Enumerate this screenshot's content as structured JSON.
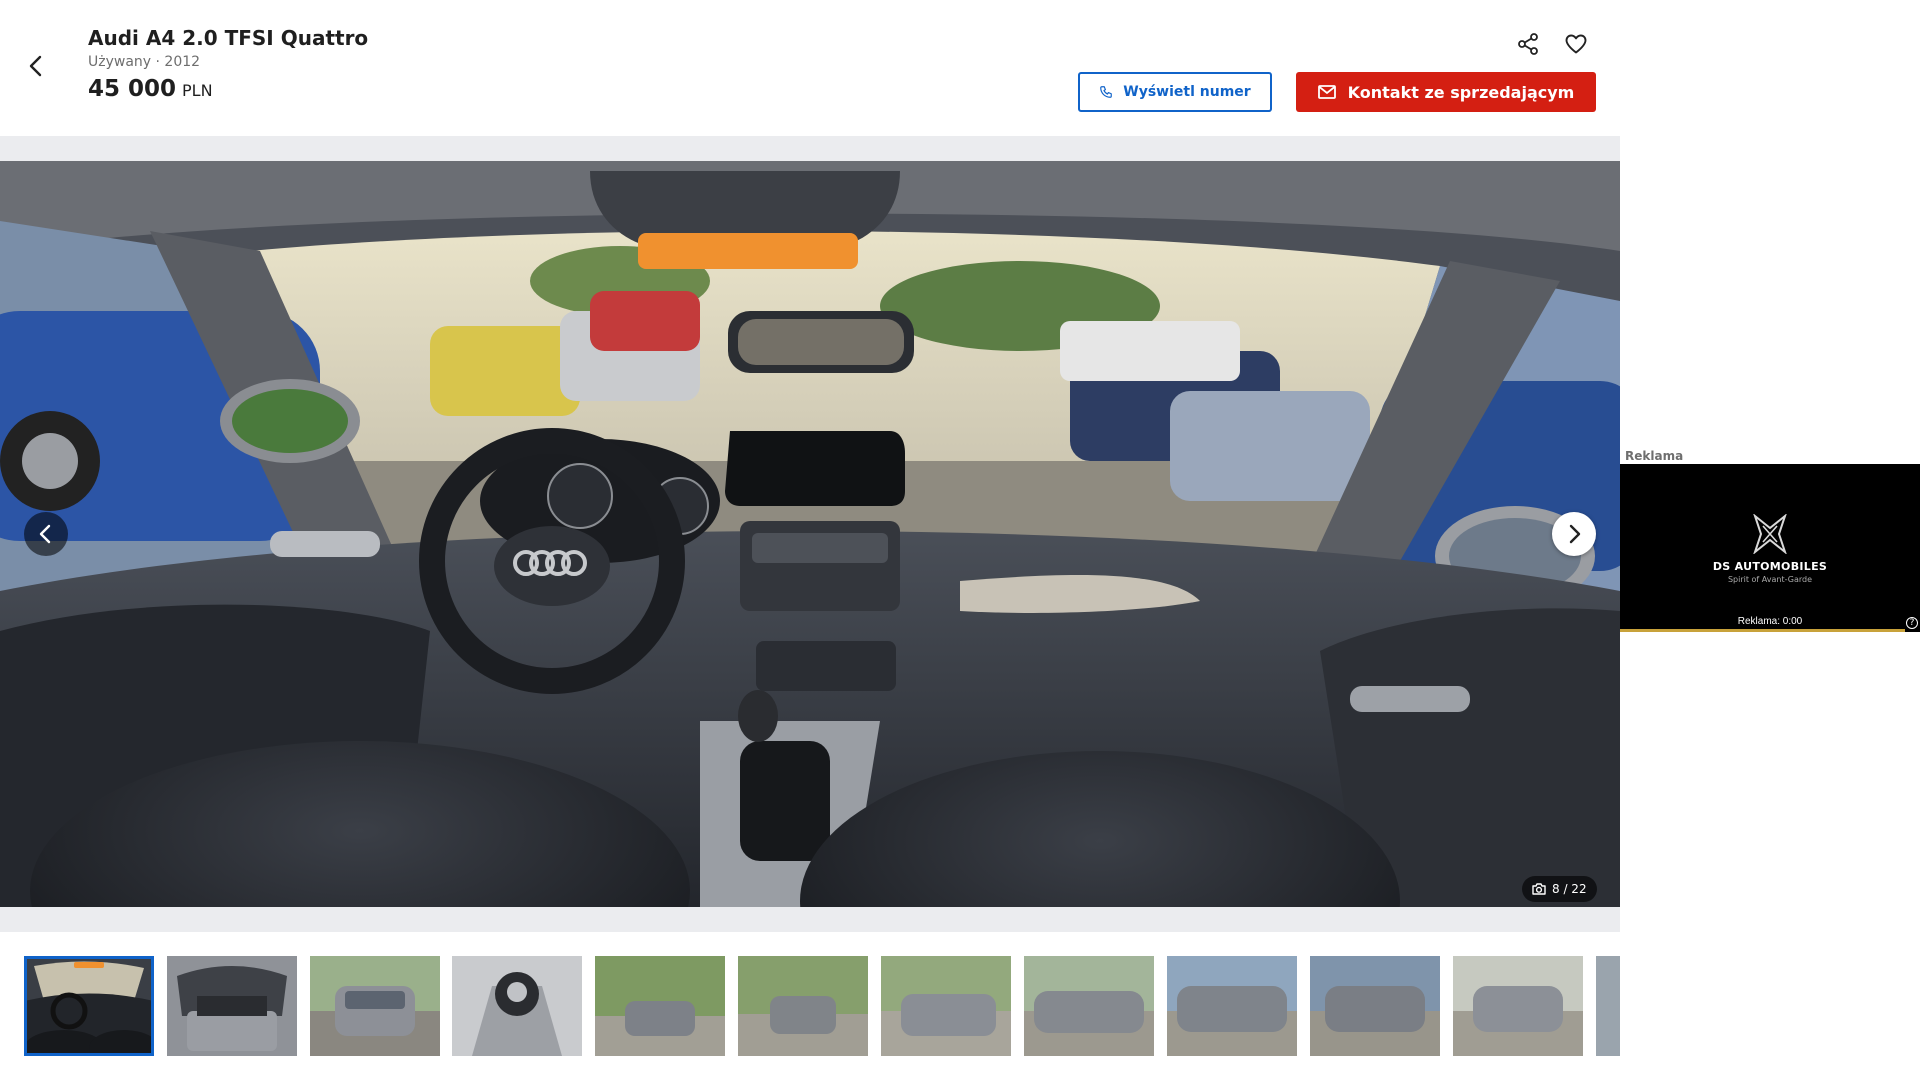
{
  "header": {
    "title": "Audi A4 2.0 TFSI Quattro",
    "subtitle": "Używany · 2012",
    "price_amount": "45 000",
    "price_currency": "PLN",
    "back_icon": "chevron-left-icon",
    "share_icon": "share-icon",
    "favorite_icon": "heart-icon"
  },
  "actions": {
    "phone_label": "Wyświetl numer",
    "contact_label": "Kontakt ze sprzedającym",
    "phone_color": "#1063c9",
    "contact_color": "#d41f12"
  },
  "gallery": {
    "counter": "8 / 22",
    "current_index": 8,
    "total": 22,
    "prev_icon": "chevron-left-icon",
    "next_icon": "chevron-right-icon",
    "thumbnails": [
      {
        "name": "interior-dashboard",
        "active": true
      },
      {
        "name": "trunk-open",
        "active": false
      },
      {
        "name": "front-view",
        "active": false
      },
      {
        "name": "gear-shifter",
        "active": false
      },
      {
        "name": "front-parked",
        "active": false
      },
      {
        "name": "front-parked-2",
        "active": false
      },
      {
        "name": "front-three-quarter",
        "active": false
      },
      {
        "name": "side-view",
        "active": false
      },
      {
        "name": "side-view-2",
        "active": false
      },
      {
        "name": "rear-three-quarter",
        "active": false
      },
      {
        "name": "rear-view",
        "active": false
      }
    ]
  },
  "sidebar_ad": {
    "label": "Reklama",
    "brand": "DS AUTOMOBILES",
    "tagline": "Spirit of Avant-Garde",
    "timer": "Reklama: 0:00",
    "progress": 0.95
  }
}
